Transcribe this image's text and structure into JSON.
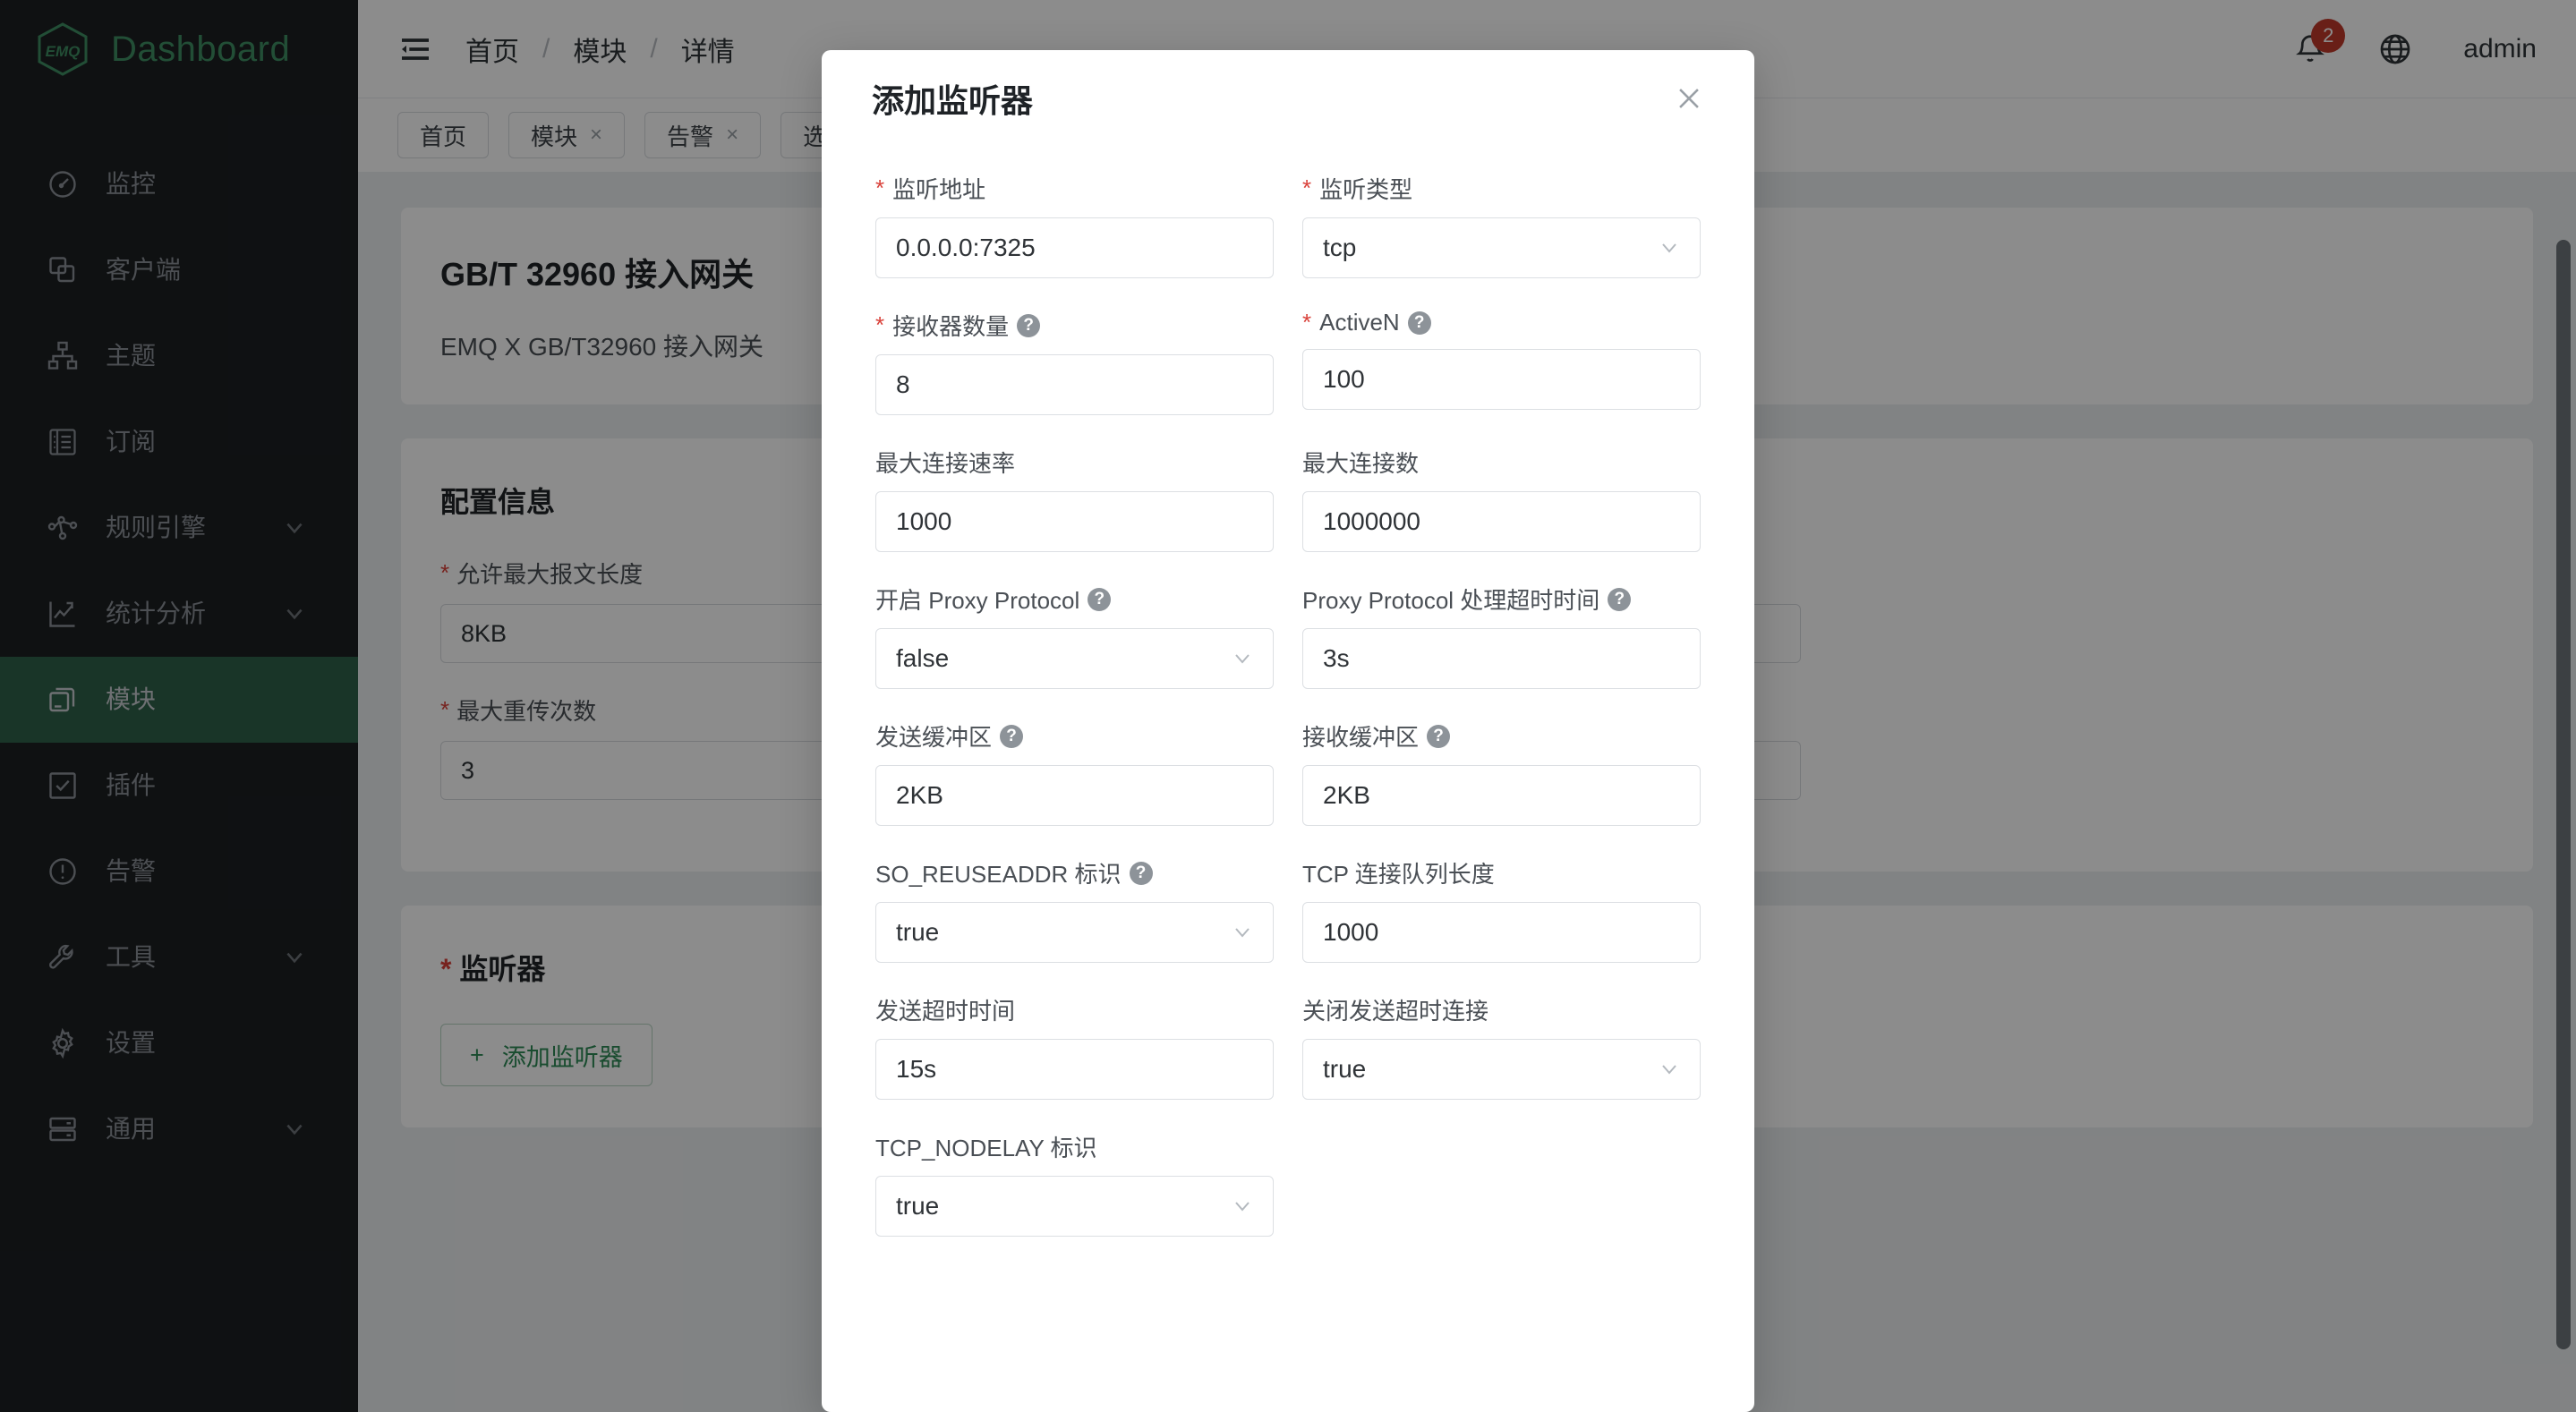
{
  "brand": {
    "logo_text": "EMQ",
    "name": "Dashboard"
  },
  "sidebar": {
    "items": [
      {
        "label": "监控",
        "icon": "dashboard-icon",
        "active": false,
        "expandable": false
      },
      {
        "label": "客户端",
        "icon": "clients-icon",
        "active": false,
        "expandable": false
      },
      {
        "label": "主题",
        "icon": "topics-icon",
        "active": false,
        "expandable": false
      },
      {
        "label": "订阅",
        "icon": "subscriptions-icon",
        "active": false,
        "expandable": false
      },
      {
        "label": "规则引擎",
        "icon": "rule-engine-icon",
        "active": false,
        "expandable": true
      },
      {
        "label": "统计分析",
        "icon": "analytics-icon",
        "active": false,
        "expandable": true
      },
      {
        "label": "模块",
        "icon": "modules-icon",
        "active": true,
        "expandable": false
      },
      {
        "label": "插件",
        "icon": "plugins-icon",
        "active": false,
        "expandable": false
      },
      {
        "label": "告警",
        "icon": "alarm-icon",
        "active": false,
        "expandable": false
      },
      {
        "label": "工具",
        "icon": "tools-icon",
        "active": false,
        "expandable": true
      },
      {
        "label": "设置",
        "icon": "settings-icon",
        "active": false,
        "expandable": false
      },
      {
        "label": "通用",
        "icon": "general-icon",
        "active": false,
        "expandable": true
      }
    ]
  },
  "topbar": {
    "menu_icon": "hamburger-icon",
    "breadcrumb": [
      "首页",
      "模块",
      "详情"
    ],
    "separator": "/",
    "notification_count": "2",
    "language_icon": "globe-icon",
    "user": "admin"
  },
  "tabs": [
    {
      "label": "首页",
      "closable": false
    },
    {
      "label": "模块",
      "closable": true
    },
    {
      "label": "告警",
      "closable": true
    },
    {
      "label": "选择模块",
      "closable": true
    }
  ],
  "tab_close_glyph": "×",
  "page": {
    "header_card": {
      "title": "GB/T 32960 接入网关",
      "subtitle": "EMQ X GB/T32960 接入网关"
    },
    "config_card": {
      "title": "配置信息",
      "fields": [
        {
          "label": "允许最大报文长度",
          "required": true,
          "value": "8KB"
        },
        {
          "label": "最大重传次数",
          "required": true,
          "value": "3"
        }
      ]
    },
    "listener_card": {
      "title": "监听器",
      "required": true,
      "add_button": {
        "plus": "+",
        "label": "添加监听器"
      }
    }
  },
  "modal": {
    "title": "添加监听器",
    "close_glyph": "✕",
    "fields": [
      {
        "label": "监听地址",
        "required": true,
        "help": false,
        "type": "input",
        "value": "0.0.0.0:7325"
      },
      {
        "label": "监听类型",
        "required": true,
        "help": false,
        "type": "select",
        "value": "tcp"
      },
      {
        "label": "接收器数量",
        "required": true,
        "help": true,
        "type": "input",
        "value": "8"
      },
      {
        "label": "ActiveN",
        "required": true,
        "help": true,
        "type": "input",
        "value": "100"
      },
      {
        "label": "最大连接速率",
        "required": false,
        "help": false,
        "type": "input",
        "value": "1000"
      },
      {
        "label": "最大连接数",
        "required": false,
        "help": false,
        "type": "input",
        "value": "1000000"
      },
      {
        "label": "开启 Proxy Protocol",
        "required": false,
        "help": true,
        "type": "select",
        "value": "false"
      },
      {
        "label": "Proxy Protocol 处理超时时间",
        "required": false,
        "help": true,
        "type": "input",
        "value": "3s"
      },
      {
        "label": "发送缓冲区",
        "required": false,
        "help": true,
        "type": "input",
        "value": "2KB"
      },
      {
        "label": "接收缓冲区",
        "required": false,
        "help": true,
        "type": "input",
        "value": "2KB"
      },
      {
        "label": "SO_REUSEADDR 标识",
        "required": false,
        "help": true,
        "type": "select",
        "value": "true"
      },
      {
        "label": "TCP 连接队列长度",
        "required": false,
        "help": false,
        "type": "input",
        "value": "1000"
      },
      {
        "label": "发送超时时间",
        "required": false,
        "help": false,
        "type": "input",
        "value": "15s"
      },
      {
        "label": "关闭发送超时连接",
        "required": false,
        "help": false,
        "type": "select",
        "value": "true"
      },
      {
        "label": "TCP_NODELAY 标识",
        "required": false,
        "help": false,
        "type": "select",
        "value": "true"
      }
    ],
    "help_glyph": "?",
    "required_glyph": "*"
  },
  "colors": {
    "sidebar_bg": "#1c1f22",
    "active_green": "#2e6149",
    "brand_green": "#3e8f63",
    "required_red": "#d9413a",
    "badge_red": "#c0392b"
  }
}
